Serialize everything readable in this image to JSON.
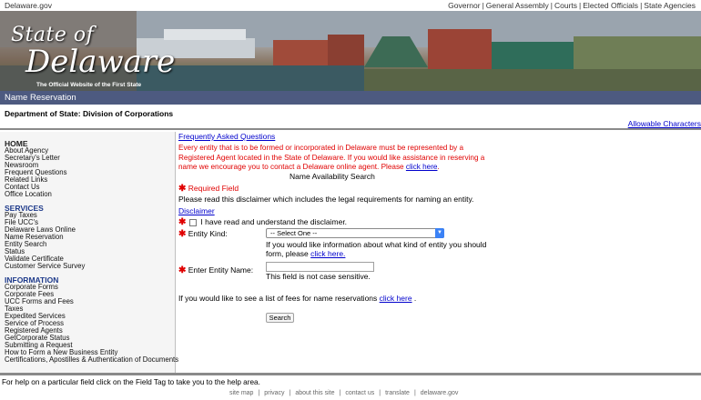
{
  "topbar": {
    "site": "Delaware.gov",
    "links": [
      "Governor",
      "General Assembly",
      "Courts",
      "Elected Officials",
      "State Agencies"
    ]
  },
  "banner": {
    "state_of": "State of",
    "delaware": "Delaware",
    "tagline": "The Official Website of the First State"
  },
  "page": {
    "title": "Name Reservation",
    "department": "Department of State: Division of Corporations",
    "allowable_characters": "Allowable Characters"
  },
  "sidebar": {
    "home": "HOME",
    "home_items": [
      "About Agency",
      "Secretary's Letter",
      "Newsroom",
      "Frequent Questions",
      "Related Links",
      "Contact Us",
      "Office Location"
    ],
    "services": "SERVICES",
    "services_items": [
      "Pay Taxes",
      "File UCC's",
      "Delaware Laws Online",
      "Name Reservation",
      "Entity Search",
      "Status",
      "Validate Certificate",
      "Customer Service Survey"
    ],
    "information": "INFORMATION",
    "information_items": [
      "Corporate Forms",
      "Corporate Fees",
      "UCC Forms and Fees",
      "Taxes",
      "Expedited Services",
      "Service of Process",
      "Registered Agents",
      "GetCorporate Status",
      "Submitting a Request",
      "How to Form a New Business Entity",
      "Certifications, Apostilles & Authentication of Documents"
    ]
  },
  "main": {
    "faq": "Frequently Asked Questions",
    "notice": "Every entity that is to be formed or incorporated in Delaware must be represented by a Registered Agent located in the State of Delaware. If you would like assistance in reserving a name we encourage you to contact a Delaware online agent. Please",
    "notice_link": "click here",
    "heading": "Name Availability Search",
    "required_field": "Required Field",
    "read_disclaimer": "Please read this disclaimer which includes the legal requirements for naming an entity.",
    "disclaimer": "Disclaimer",
    "check_label": "I have read and understand the disclaimer.",
    "entity_kind_label": "Entity Kind:",
    "entity_kind_selected": "-- Select One --",
    "kind_info": "If you would like information about what kind of entity you should form, please",
    "kind_info_link": "click here.",
    "entity_name_label": "Enter Entity Name:",
    "entity_name_value": "",
    "case_info": "This field is not case sensitive.",
    "fee_text": "If you would like to see a list of fees for name reservations",
    "fee_link": "click here",
    "search": "Search"
  },
  "footer": {
    "help": "For help on a particular field click on the Field Tag to take you to the help area.",
    "links": [
      "site map",
      "privacy",
      "about this site",
      "contact us",
      "translate",
      "delaware.gov"
    ]
  }
}
